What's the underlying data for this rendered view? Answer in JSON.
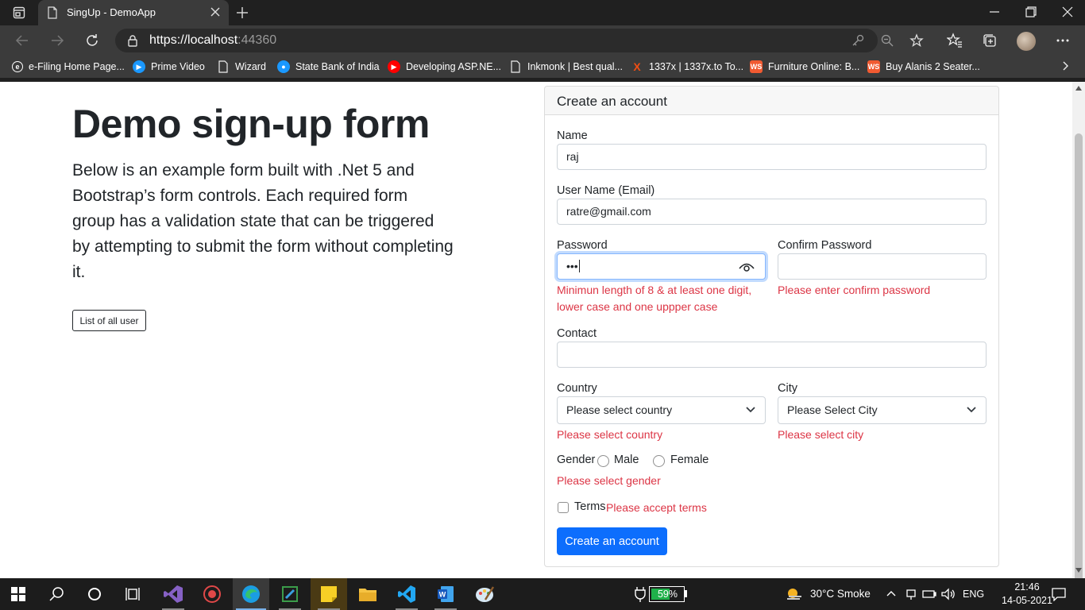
{
  "browser": {
    "tab_title": "SingUp - DemoApp",
    "url_main": "https://localhost",
    "url_port": ":44360",
    "bookmarks": [
      {
        "label": "e-Filing Home Page...",
        "icon": "efiling-icon",
        "color": "#3b3b3b"
      },
      {
        "label": "Prime Video",
        "icon": "prime-video-icon",
        "color": "#1a98ff"
      },
      {
        "label": "Wizard",
        "icon": "page-icon",
        "color": "#3b3b3b"
      },
      {
        "label": "State Bank of India",
        "icon": "sbi-icon",
        "color": "#1a98ff"
      },
      {
        "label": "Developing ASP.NE...",
        "icon": "youtube-icon",
        "color": "#ff0000"
      },
      {
        "label": "Inkmonk | Best qual...",
        "icon": "page-icon",
        "color": "#3b3b3b"
      },
      {
        "label": "1337x | 1337x.to To...",
        "icon": "1337x-icon",
        "color": "#f14e13"
      },
      {
        "label": "Furniture Online: B...",
        "icon": "ws-icon",
        "color": "#f15a31"
      },
      {
        "label": "Buy Alanis 2 Seater...",
        "icon": "ws-icon",
        "color": "#f15a31"
      }
    ]
  },
  "hero": {
    "title": "Demo sign-up form",
    "description": "Below is an example form built with .Net 5 and Bootstrap’s form controls. Each required form group has a validation state that can be triggered by attempting to submit the form without completing it.",
    "list_button": "List of all user"
  },
  "form": {
    "header": "Create an account",
    "name": {
      "label": "Name",
      "value": "raj"
    },
    "email": {
      "label": "User Name (Email)",
      "value": "ratre@gmail.com"
    },
    "password": {
      "label": "Password",
      "value": "•••",
      "error": "Minimun length of 8 & at least one digit, lower case and one uppper case"
    },
    "confirm_password": {
      "label": "Confirm Password",
      "value": "",
      "error": "Please enter confirm password"
    },
    "contact": {
      "label": "Contact",
      "value": ""
    },
    "country": {
      "label": "Country",
      "selected": "Please select country",
      "error": "Please select country"
    },
    "city": {
      "label": "City",
      "selected": "Please Select City",
      "error": "Please select city"
    },
    "gender": {
      "label": "Gender",
      "options": [
        "Male",
        "Female"
      ],
      "error": "Please select gender"
    },
    "terms": {
      "label": "Terms",
      "error": "Please accept terms"
    },
    "submit": "Create an account"
  },
  "taskbar": {
    "battery_percent": "59%",
    "battery_level": 0.59,
    "weather": "30°C  Smoke",
    "language": "ENG",
    "time": "21:46",
    "date": "14-05-2021"
  }
}
